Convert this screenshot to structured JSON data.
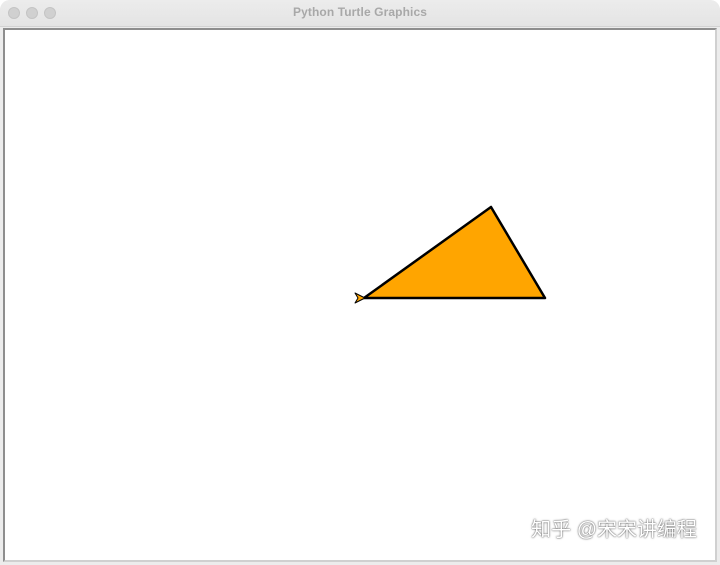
{
  "window": {
    "title": "Python Turtle Graphics"
  },
  "colors": {
    "fill": "#FFA500",
    "outline": "#000000",
    "cursor_fill": "#FFA500"
  },
  "drawing": {
    "shape": "triangle",
    "cursor_icon": "turtle-arrow-icon"
  },
  "watermark": {
    "text": "知乎 @宋宋讲编程"
  }
}
